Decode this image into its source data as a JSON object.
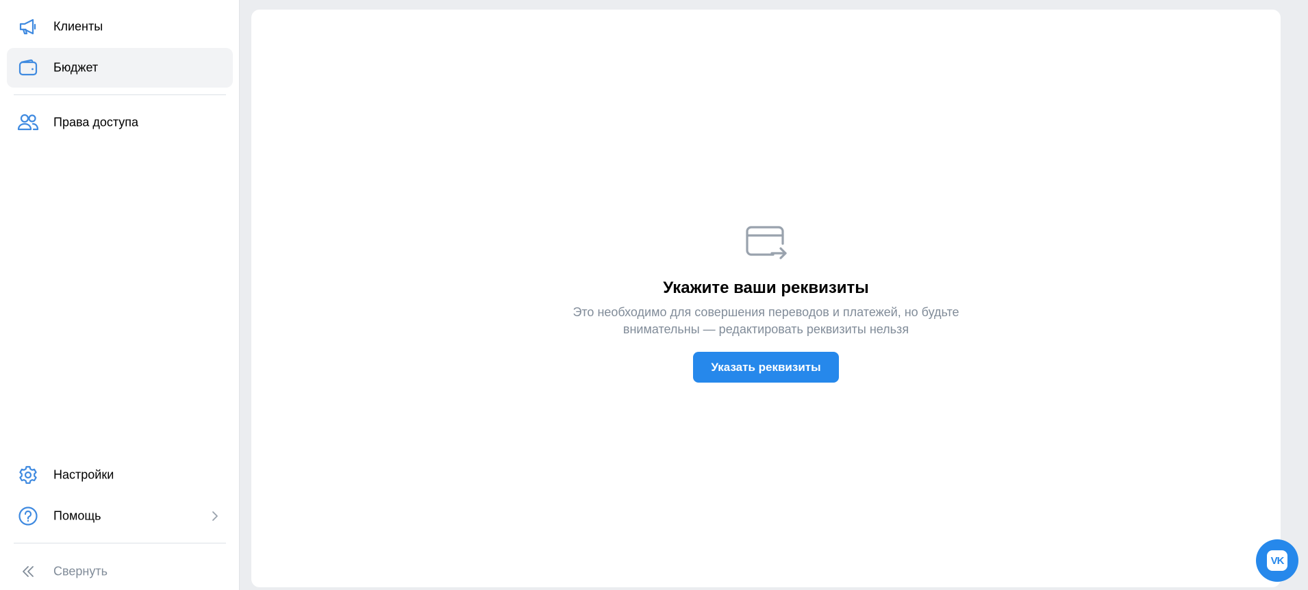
{
  "sidebar": {
    "items": [
      {
        "label": "Клиенты",
        "icon": "megaphone-icon",
        "active": false
      },
      {
        "label": "Бюджет",
        "icon": "wallet-icon",
        "active": true
      },
      {
        "label": "Права доступа",
        "icon": "users-icon",
        "active": false
      }
    ],
    "bottom_items": [
      {
        "label": "Настройки",
        "icon": "gear-icon"
      },
      {
        "label": "Помощь",
        "icon": "help-circle-icon",
        "has_chevron": true
      }
    ],
    "collapse_label": "Свернуть"
  },
  "main": {
    "empty_state": {
      "icon": "card-arrow-icon",
      "title": "Укажите ваши реквизиты",
      "description": "Это необходимо для совершения переводов и платежей, но будьте внимательны — редактировать реквизиты нельзя",
      "button_label": "Указать реквизиты"
    }
  },
  "fab": {
    "icon": "vk-logo-icon",
    "logo_text": "VK"
  },
  "colors": {
    "accent": "#2688eb",
    "icon_blue": "#3f8ae0",
    "muted_text": "#818c99",
    "background": "#ebedf0",
    "active_item_bg": "#f2f3f5"
  }
}
